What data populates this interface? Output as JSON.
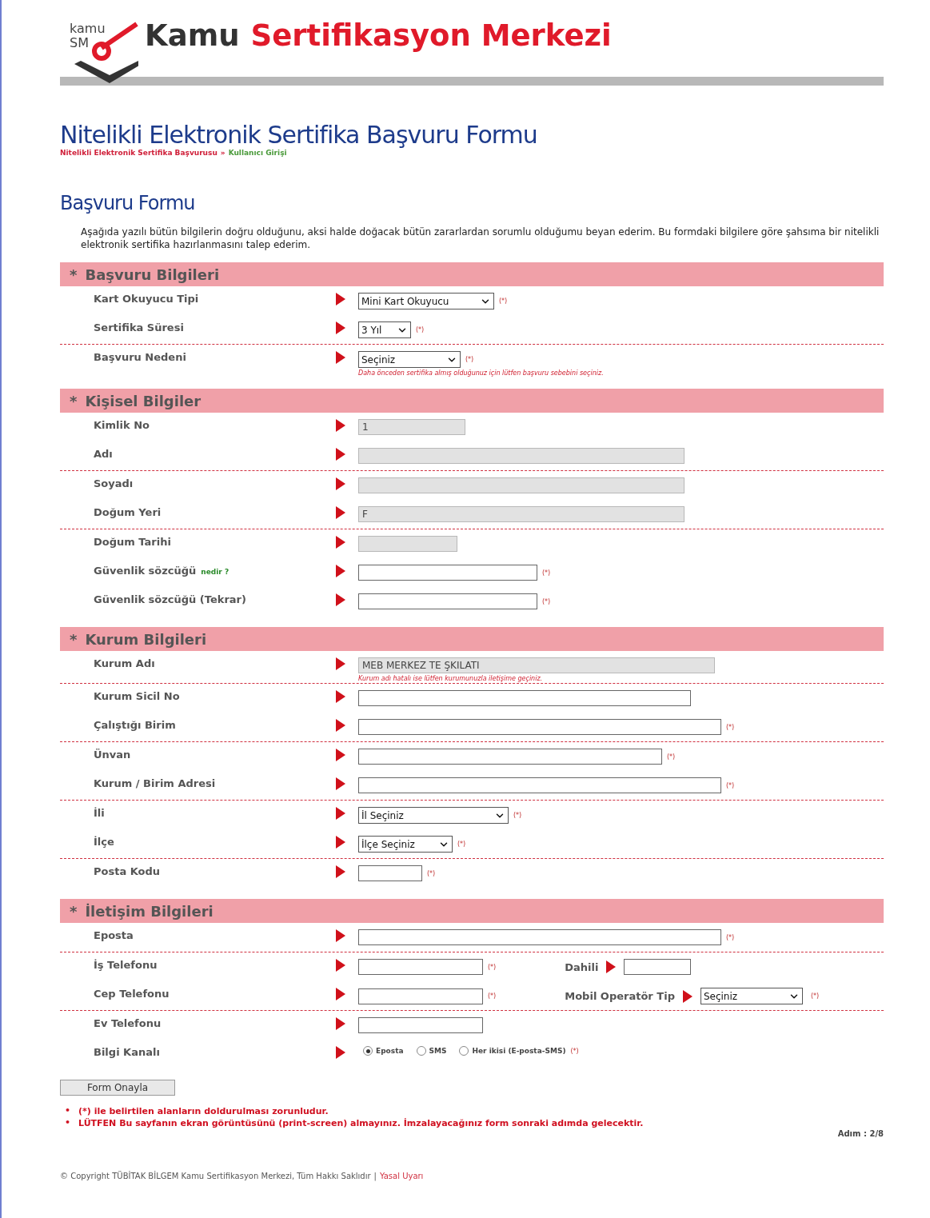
{
  "logo": {
    "small_top": "kamu",
    "small_bottom": "SM",
    "name_first": "Kamu",
    "name_rest": "Sertifikasyon Merkezi"
  },
  "page_title": "Nitelikli Elektronik Sertifika Başvuru Formu",
  "breadcrumb": {
    "first": "Nitelikli Elektronik Sertifika Başvurusu",
    "separator": "»",
    "current": "Kullanıcı Girişi"
  },
  "form_title": "Başvuru Formu",
  "intro": "Aşağıda yazılı bütün bilgilerin doğru olduğunu, aksi halde doğacak bütün zararlardan sorumlu olduğumu beyan ederim. Bu formdaki bilgilere göre şahsıma bir nitelikli elektronik sertifika hazırlanmasını talep ederim.",
  "sections": [
    {
      "bullet": "*",
      "title": "Başvuru Bilgileri",
      "rows": [
        {
          "label": "Kart Okuyucu Tipi",
          "kind": "select",
          "value": "Mini Kart Okuyucu",
          "mark": "(*)"
        },
        {
          "label": "Sertifika Süresi",
          "kind": "select",
          "value": "3 Yıl",
          "mark": "(*)",
          "divider_after": true
        },
        {
          "label": "Başvuru Nedeni",
          "kind": "select",
          "value": "Seçiniz",
          "mark": "(*)",
          "note": "Daha önceden sertifika almış olduğunuz için lütfen başvuru sebebini seçiniz."
        }
      ]
    },
    {
      "bullet": "*",
      "title": "Kişisel Bilgiler",
      "rows": [
        {
          "label": "Kimlik No",
          "kind": "readonly",
          "value": "1"
        },
        {
          "label": "Adı",
          "kind": "readonly",
          "divider_after": true
        },
        {
          "label": "Soyadı",
          "kind": "readonly"
        },
        {
          "label": "Doğum Yeri",
          "kind": "readonly",
          "value": "F",
          "divider_after": true
        },
        {
          "label": "Doğum Tarihi",
          "kind": "readonly"
        },
        {
          "label": "Güvenlik sözcüğü",
          "link": "nedir ?",
          "kind": "input",
          "mark": "(*)"
        },
        {
          "label": "Güvenlik sözcüğü (Tekrar)",
          "kind": "input",
          "mark": "(*)"
        }
      ]
    },
    {
      "bullet": "*",
      "title": "Kurum Bilgileri",
      "rows": [
        {
          "label": "Kurum Adı",
          "kind": "readonly",
          "value": "MEB MERKEZ TE ŞKILATI",
          "note": "Kurum adı hatalı ise lütfen kurumunuzla iletişime geçiniz.",
          "divider_after": true
        },
        {
          "label": "Kurum Sicil No",
          "kind": "input"
        },
        {
          "label": "Çalıştığı Birim",
          "kind": "input",
          "mark": "(*)",
          "divider_after": true
        },
        {
          "label": "Ünvan",
          "kind": "input",
          "mark": "(*)"
        },
        {
          "label": "Kurum / Birim Adresi",
          "kind": "input",
          "mark": "(*)",
          "divider_after": true
        },
        {
          "label": "İli",
          "kind": "select",
          "value": "İl Seçiniz",
          "mark": "(*)"
        },
        {
          "label": "İlçe",
          "kind": "select",
          "value": "İlçe Seçiniz",
          "mark": "(*)",
          "divider_after": true
        },
        {
          "label": "Posta Kodu",
          "kind": "input",
          "mark": "(*)"
        }
      ]
    },
    {
      "bullet": "*",
      "title": "İletişim Bilgileri",
      "rows": [
        {
          "label": "Eposta",
          "kind": "input",
          "mark": "(*)",
          "divider_after": true
        },
        {
          "label": "İş Telefonu",
          "kind": "input",
          "mark": "(*)",
          "extra": {
            "label": "Dahili",
            "kind": "input"
          }
        },
        {
          "label": "Cep Telefonu",
          "kind": "input",
          "mark": "(*)",
          "extra": {
            "label": "Mobil Operatör Tip",
            "kind": "select",
            "value": "Seçiniz",
            "mark": "(*)"
          },
          "divider_after": true
        },
        {
          "label": "Ev Telefonu",
          "kind": "input"
        },
        {
          "label": "Bilgi Kanalı",
          "kind": "radio",
          "options": [
            {
              "label": "Eposta",
              "selected": true
            },
            {
              "label": "SMS",
              "selected": false
            },
            {
              "label": "Her ikisi (E-posta-SMS)",
              "selected": false
            }
          ],
          "mark": "(*)"
        }
      ]
    }
  ],
  "submit": "Form Onayla",
  "notes": [
    {
      "bullet": "•",
      "text": "(*) ile belirtilen alanların doldurulması zorunludur."
    },
    {
      "bullet": "•",
      "text": "LÜTFEN Bu sayfanın ekran görüntüsünü (print-screen) almayınız. İmzalayacağınız form sonraki adımda gelecektir."
    }
  ],
  "step": "Adım : 2/8",
  "footer": {
    "copyright": "© Copyright TÜBİTAK BİLGEM Kamu Sertifikasyon Merkezi, Tüm Hakkı Saklıdır",
    "separator": "|",
    "link": "Yasal Uyarı"
  }
}
